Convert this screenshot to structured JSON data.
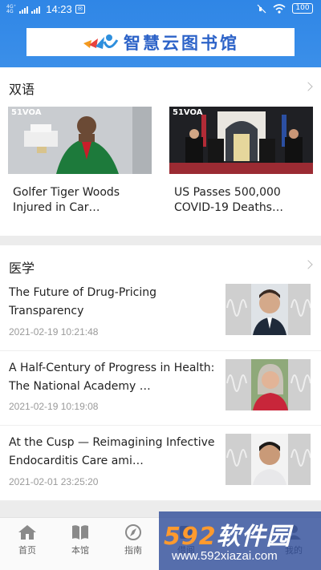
{
  "status_bar": {
    "network_top": "4G⁺",
    "network_bottom": "4G",
    "time": "14:23",
    "battery": "100"
  },
  "header": {
    "title": "智慧云图书馆"
  },
  "bilingual": {
    "title": "双语",
    "cards": [
      {
        "title": "Golfer Tiger Woods Injured in Car…",
        "badge": "51VOA"
      },
      {
        "title": "US Passes 500,000 COVID-19 Deaths…",
        "badge": "51VOA"
      }
    ]
  },
  "medicine": {
    "title": "医学",
    "items": [
      {
        "title": "The Future of Drug-Pricing Transparency",
        "date": "2021-02-19 10:21:48"
      },
      {
        "title": "A Half-Century of Progress in Health: The National Academy …",
        "date": "2021-02-19 10:19:08"
      },
      {
        "title": "At the Cusp — Reimagining Infective Endocarditis Care ami…",
        "date": "2021-02-01 23:25:20"
      }
    ]
  },
  "tabbar": {
    "tabs": [
      {
        "label": "首页",
        "icon": "home-icon"
      },
      {
        "label": "本馆",
        "icon": "book-icon"
      },
      {
        "label": "指南",
        "icon": "compass-icon"
      },
      {
        "label": "借阅",
        "icon": "borrow-icon"
      },
      {
        "label": "我的",
        "icon": "user-icon"
      }
    ]
  },
  "watermark": {
    "num": "592",
    "text": "软件园",
    "url": "www.592xiazai.com"
  },
  "colors": {
    "header_blue": "#2f86e6",
    "brand_text": "#2d63c8",
    "date_gray": "#9a9a9a"
  }
}
